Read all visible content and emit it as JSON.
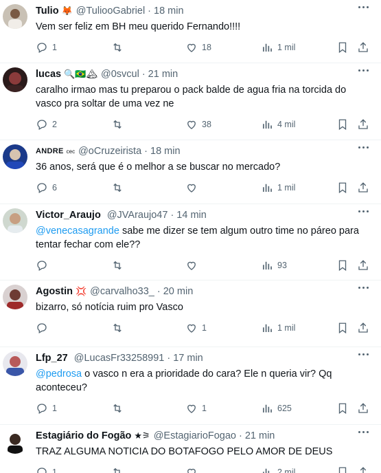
{
  "tweets": [
    {
      "name": "Tulio",
      "badges": "🦊",
      "handle": "@TulioоGabriel",
      "time": "18 min",
      "text": "Vem ser feliz em BH meu querido Fernando!!!!",
      "mention": "",
      "replies": "1",
      "retweets": "",
      "likes": "18",
      "views": "1 mil"
    },
    {
      "name": "lucas",
      "badges": "🔍🇧🇷🏔",
      "handle": "@0svcul",
      "time": "21 min",
      "text": "caralho irmao mas tu preparou o pack balde de agua fria na torcida do vasco pra soltar de uma vez ne",
      "mention": "",
      "replies": "2",
      "retweets": "",
      "likes": "38",
      "views": "4 mil"
    },
    {
      "name": "ANDRE",
      "badges": "cec",
      "handle": "@oCruzeirista",
      "time": "18 min",
      "text": "36 anos, será que é o melhor a se buscar no mercado?",
      "mention": "",
      "replies": "6",
      "retweets": "",
      "likes": "",
      "views": "1 mil"
    },
    {
      "name": "Victor_Araujo",
      "badges": "",
      "handle": "@JVAraujo47",
      "time": "14 min",
      "text": " sabe me dizer se tem algum outro time no páreo para tentar fechar com ele??",
      "mention": "@venecasagrande",
      "replies": "",
      "retweets": "",
      "likes": "",
      "views": "93"
    },
    {
      "name": "Agostin",
      "badges": "💢",
      "handle": "@carvalho33_",
      "time": "20 min",
      "text": "bizarro, só notícia ruim pro Vasco",
      "mention": "",
      "replies": "",
      "retweets": "",
      "likes": "1",
      "views": "1 mil"
    },
    {
      "name": "Lfp_27",
      "badges": "",
      "handle": "@LucasFr33258991",
      "time": "17 min",
      "text": " o vasco n era a prioridade do cara? Ele n queria vir? Qq aconteceu?",
      "mention": "@pedrosa",
      "replies": "1",
      "retweets": "",
      "likes": "1",
      "views": "625"
    },
    {
      "name": "Estagiário do Fogão",
      "badges": "★⚞",
      "handle": "@EstagiarioFogao",
      "time": "21 min",
      "text": "TRAZ ALGUMA NOTICIA DO BOTAFOGO PELO AMOR DE DEUS",
      "mention": "",
      "replies": "1",
      "retweets": "",
      "likes": "",
      "views": "2 mil"
    }
  ]
}
